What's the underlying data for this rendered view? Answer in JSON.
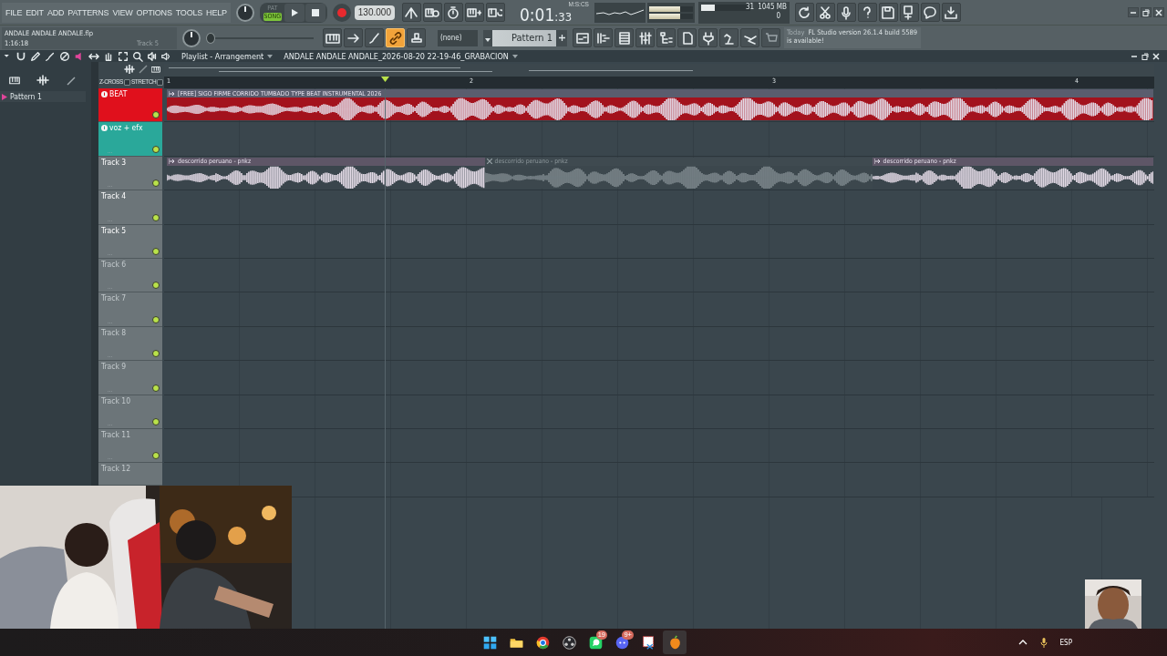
{
  "menu": [
    "FILE",
    "EDIT",
    "ADD",
    "PATTERNS",
    "VIEW",
    "OPTIONS",
    "TOOLS",
    "HELP"
  ],
  "hint_panel": {
    "file": "ANDALE ANDALE ANDALE.flp",
    "position": "1:16:18",
    "hint": "Track 5"
  },
  "transport": {
    "modes": [
      {
        "label": "PAT",
        "selected": false
      },
      {
        "label": "SONG",
        "selected": true
      }
    ],
    "playing": false,
    "recording": true,
    "tempo": "130.000"
  },
  "toggles_row_1": [
    {
      "on": false
    },
    {
      "on": false
    },
    {
      "on": false
    },
    {
      "on": false
    },
    {
      "on": false
    }
  ],
  "toggles_row_2": [
    {
      "on": false
    },
    {
      "on": false
    },
    {
      "on": false
    },
    {
      "on": true
    },
    {
      "on": false
    }
  ],
  "pitch_slider": {
    "level": 0.0
  },
  "time": {
    "main": "0:01",
    "small": ":33",
    "unit": "M:S:CS"
  },
  "peak_meter": [
    {
      "level": 0.7
    },
    {
      "level": 0.7
    }
  ],
  "cpu": {
    "level": 0.28,
    "polyphony": "31",
    "memory": "1045 MB",
    "voices": "0"
  },
  "pattern_selector": {
    "preset": "(none)",
    "pattern": "Pattern 1"
  },
  "news": {
    "date": "Today",
    "message": "FL Studio version 26.1.4 build 5589 is available!"
  },
  "playlist": {
    "title": "Playlist - Arrangement",
    "song": "ANDALE ANDALE ANDALE_2026-08-20 22-19-46_GRABACION",
    "picker": [
      {
        "label": "Pattern 1",
        "selected": true
      }
    ],
    "options": [
      {
        "label": "Z-CROSS",
        "checked": false
      },
      {
        "label": "STRETCH",
        "checked": false
      }
    ],
    "ruler": [
      "1",
      "2",
      "3",
      "4"
    ],
    "tracks": [
      {
        "name": "BEAT",
        "color": "#e0101c",
        "linked": true,
        "dimmed": false,
        "enabled": true,
        "clips": [
          {
            "title": "[FREE] SIGO FIRME CORRIDO TUMBADO TYPE BEAT INSTRUMENTAL 2026",
            "muted": false
          }
        ]
      },
      {
        "name": "voz + efx",
        "dots": "...",
        "color": "#2aa89a",
        "linked": true,
        "dimmed": false,
        "enabled": true
      },
      {
        "name": "Track 3",
        "dots": "...",
        "color": "#6c7579",
        "linked": false,
        "dimmed": false,
        "enabled": true,
        "clips": [
          {
            "title": "descorrido peruano - pnkz",
            "muted": false
          },
          {
            "title": "descorrido peruano - pnkz",
            "muted": true
          },
          {
            "title": "descorrido peruano - pnkz",
            "muted": false
          }
        ]
      },
      {
        "name": "Track 4",
        "dots": "...",
        "color": "#6c7579",
        "linked": false,
        "dimmed": false,
        "enabled": true
      },
      {
        "name": "Track 5",
        "dots": "...",
        "color": "#6c7579",
        "linked": false,
        "dimmed": false,
        "enabled": true
      },
      {
        "name": "Track 6",
        "dots": "...",
        "color": "#6c7579",
        "linked": false,
        "dimmed": true,
        "enabled": true
      },
      {
        "name": "Track 7",
        "dots": "...",
        "color": "#6c7579",
        "linked": false,
        "dimmed": true,
        "enabled": true
      },
      {
        "name": "Track 8",
        "dots": "...",
        "color": "#6c7579",
        "linked": false,
        "dimmed": true,
        "enabled": true
      },
      {
        "name": "Track 9",
        "dots": "...",
        "color": "#6c7579",
        "linked": false,
        "dimmed": true,
        "enabled": true
      },
      {
        "name": "Track 10",
        "dots": "...",
        "color": "#6c7579",
        "linked": false,
        "dimmed": true,
        "enabled": true
      },
      {
        "name": "Track 11",
        "dots": "...",
        "color": "#6c7579",
        "linked": false,
        "dimmed": true,
        "enabled": true
      },
      {
        "name": "Track 12",
        "color": "#6c7579",
        "linked": false,
        "dimmed": true
      }
    ]
  },
  "taskbar": {
    "apps": [
      {
        "kind": "start",
        "selected": false
      },
      {
        "kind": "folder",
        "selected": false
      },
      {
        "kind": "browser",
        "selected": false
      },
      {
        "kind": "recorder",
        "selected": false
      },
      {
        "kind": "chat",
        "badge": "19",
        "selected": false
      },
      {
        "kind": "voice",
        "badge": "9+",
        "selected": false
      },
      {
        "kind": "snip",
        "selected": false
      },
      {
        "kind": "daw",
        "selected": true
      }
    ],
    "language": "ESP"
  }
}
